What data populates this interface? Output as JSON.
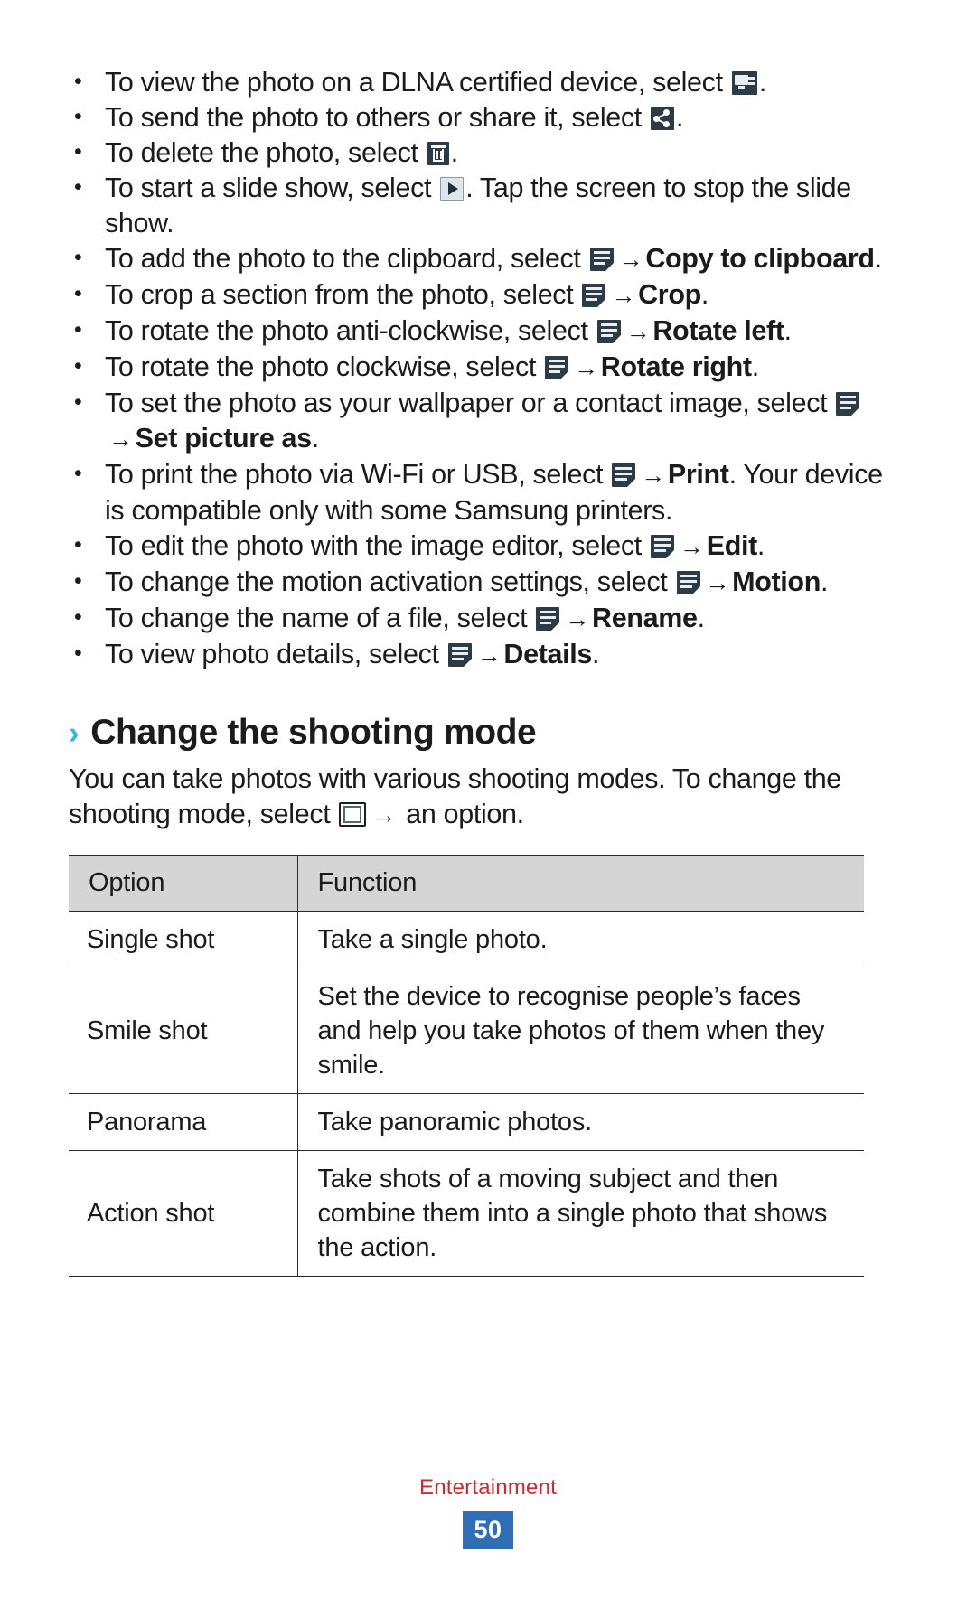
{
  "page": {
    "number": "50",
    "chapter": "Entertainment"
  },
  "colors": {
    "heading_chevron": "#2fb6ef",
    "table_header_bg": "#d5d5d5",
    "page_badge_bg": "#2f6db5",
    "chapter_text": "#d2272e",
    "icon_dark": "#2d3b44"
  },
  "bullets": [
    {
      "id": "dlna",
      "icon": "dlna-icon",
      "parts": [
        {
          "t": "To view the photo on a DLNA certified device, select "
        },
        {
          "icon": "dlna-icon"
        },
        {
          "t": "."
        }
      ]
    },
    {
      "id": "share",
      "icon": "share-icon",
      "parts": [
        {
          "t": "To send the photo to others or share it, select "
        },
        {
          "icon": "share-icon"
        },
        {
          "t": "."
        }
      ]
    },
    {
      "id": "delete",
      "icon": "trash-icon",
      "parts": [
        {
          "t": "To delete the photo, select "
        },
        {
          "icon": "trash-icon"
        },
        {
          "t": "."
        }
      ]
    },
    {
      "id": "slideshow",
      "icon": "play-icon",
      "parts": [
        {
          "t": "To start a slide show, select "
        },
        {
          "icon": "play-icon"
        },
        {
          "t": ". Tap the screen to stop the slide show."
        }
      ]
    },
    {
      "id": "copy-to-clipboard",
      "icon": "menu-icon",
      "parts": [
        {
          "t": "To add the photo to the clipboard, select "
        },
        {
          "icon": "menu-icon"
        },
        {
          "arrow": true
        },
        {
          "t": "Copy to clipboard",
          "bold": true
        },
        {
          "t": "."
        }
      ]
    },
    {
      "id": "crop",
      "icon": "menu-icon",
      "parts": [
        {
          "t": "To crop a section from the photo, select "
        },
        {
          "icon": "menu-icon"
        },
        {
          "arrow": true
        },
        {
          "t": "Crop",
          "bold": true
        },
        {
          "t": "."
        }
      ]
    },
    {
      "id": "rotate-left",
      "icon": "menu-icon",
      "parts": [
        {
          "t": "To rotate the photo anti-clockwise, select "
        },
        {
          "icon": "menu-icon"
        },
        {
          "arrow": true
        },
        {
          "t": "Rotate left",
          "bold": true
        },
        {
          "t": "."
        }
      ]
    },
    {
      "id": "rotate-right",
      "icon": "menu-icon",
      "parts": [
        {
          "t": "To rotate the photo clockwise, select "
        },
        {
          "icon": "menu-icon"
        },
        {
          "arrow": true
        },
        {
          "t": "Rotate right",
          "bold": true
        },
        {
          "t": "."
        }
      ]
    },
    {
      "id": "set-picture-as",
      "icon": "menu-icon",
      "parts": [
        {
          "t": "To set the photo as your wallpaper or a contact image, select "
        },
        {
          "icon": "menu-icon"
        },
        {
          "arrow": true
        },
        {
          "t": "Set picture as",
          "bold": true
        },
        {
          "t": "."
        }
      ]
    },
    {
      "id": "print",
      "icon": "menu-icon",
      "parts": [
        {
          "t": "To print the photo via Wi-Fi or USB, select "
        },
        {
          "icon": "menu-icon"
        },
        {
          "arrow": true
        },
        {
          "t": "Print",
          "bold": true
        },
        {
          "t": ". Your device is compatible only with some Samsung printers."
        }
      ]
    },
    {
      "id": "edit",
      "icon": "menu-icon",
      "parts": [
        {
          "t": "To edit the photo with the image editor, select "
        },
        {
          "icon": "menu-icon"
        },
        {
          "arrow": true
        },
        {
          "t": "Edit",
          "bold": true
        },
        {
          "t": "."
        }
      ]
    },
    {
      "id": "motion",
      "icon": "menu-icon",
      "parts": [
        {
          "t": "To change the motion activation settings, select "
        },
        {
          "icon": "menu-icon"
        },
        {
          "arrow": true
        },
        {
          "t": "Motion",
          "bold": true
        },
        {
          "t": "."
        }
      ]
    },
    {
      "id": "rename",
      "icon": "menu-icon",
      "parts": [
        {
          "t": "To change the name of a file, select "
        },
        {
          "icon": "menu-icon"
        },
        {
          "arrow": true
        },
        {
          "t": "Rename",
          "bold": true
        },
        {
          "t": "."
        }
      ]
    },
    {
      "id": "details",
      "icon": "menu-icon",
      "parts": [
        {
          "t": "To view photo details, select "
        },
        {
          "icon": "menu-icon"
        },
        {
          "arrow": true
        },
        {
          "t": "Details",
          "bold": true
        },
        {
          "t": "."
        }
      ]
    }
  ],
  "section": {
    "chevron": "›",
    "title": "Change the shooting mode",
    "intro_before": "You can take photos with various shooting modes. To change the shooting mode, select ",
    "intro_after": " an option."
  },
  "table": {
    "headers": [
      "Option",
      "Function"
    ],
    "rows": [
      {
        "option": "Single shot",
        "function": "Take a single photo."
      },
      {
        "option": "Smile shot",
        "function": "Set the device to recognise people’s faces and help you take photos of them when they smile."
      },
      {
        "option": "Panorama",
        "function": "Take panoramic photos."
      },
      {
        "option": "Action shot",
        "function": "Take shots of a moving subject and then combine them into a single photo that shows the action."
      }
    ]
  }
}
